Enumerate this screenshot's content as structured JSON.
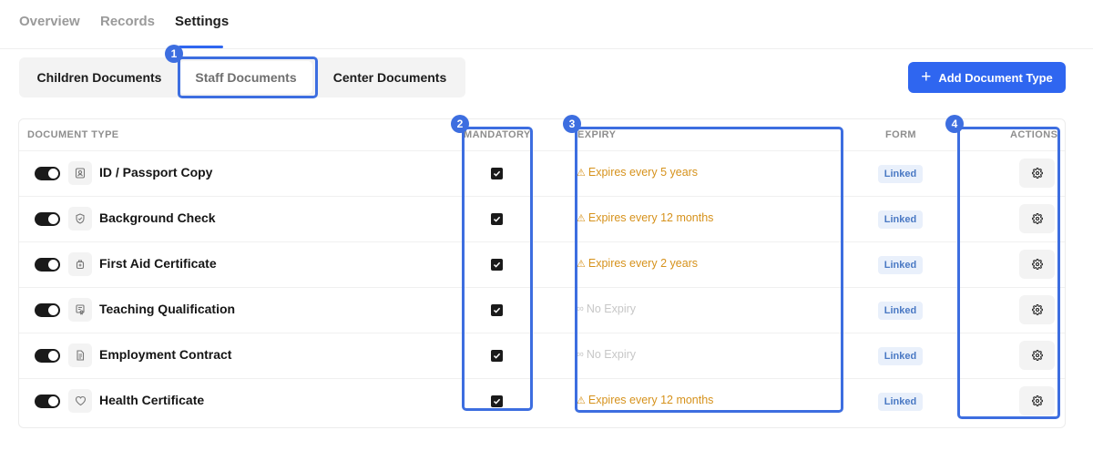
{
  "top_tabs": [
    {
      "label": "Overview",
      "active": false
    },
    {
      "label": "Records",
      "active": false
    },
    {
      "label": "Settings",
      "active": true
    }
  ],
  "segments": [
    {
      "label": "Children Documents",
      "active": false
    },
    {
      "label": "Staff Documents",
      "active": true
    },
    {
      "label": "Center Documents",
      "active": false
    }
  ],
  "add_button": {
    "label": "Add Document Type",
    "icon": "plus-icon"
  },
  "columns": {
    "document_type": "DOCUMENT TYPE",
    "mandatory": "MANDATORY",
    "expiry": "EXPIRY",
    "form": "FORM",
    "actions": "ACTIONS"
  },
  "rows": [
    {
      "name": "ID / Passport Copy",
      "icon": "id-card-icon",
      "enabled": true,
      "mandatory": true,
      "expiry": "Expires every 5 years",
      "expiry_type": "warning",
      "form": "Linked"
    },
    {
      "name": "Background Check",
      "icon": "shield-icon",
      "enabled": true,
      "mandatory": true,
      "expiry": "Expires every 12 months",
      "expiry_type": "warning",
      "form": "Linked"
    },
    {
      "name": "First Aid Certificate",
      "icon": "first-aid-icon",
      "enabled": true,
      "mandatory": true,
      "expiry": "Expires every 2 years",
      "expiry_type": "warning",
      "form": "Linked"
    },
    {
      "name": "Teaching Qualification",
      "icon": "certificate-icon",
      "enabled": true,
      "mandatory": true,
      "expiry": "No Expiry",
      "expiry_type": "none",
      "form": "Linked"
    },
    {
      "name": "Employment Contract",
      "icon": "document-icon",
      "enabled": true,
      "mandatory": true,
      "expiry": "No Expiry",
      "expiry_type": "none",
      "form": "Linked"
    },
    {
      "name": "Health Certificate",
      "icon": "heart-icon",
      "enabled": true,
      "mandatory": true,
      "expiry": "Expires every 12 months",
      "expiry_type": "warning",
      "form": "Linked"
    }
  ],
  "annotations": [
    "1",
    "2",
    "3",
    "4"
  ],
  "colors": {
    "accent": "#2f66f0",
    "warning": "#d6921c",
    "annotation": "#3d6ee0"
  }
}
